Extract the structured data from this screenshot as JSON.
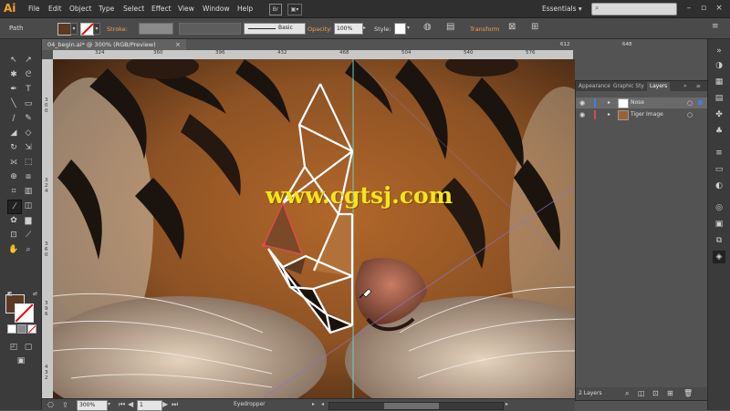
{
  "app": {
    "logo": "Ai"
  },
  "menu": [
    "File",
    "Edit",
    "Object",
    "Type",
    "Select",
    "Effect",
    "View",
    "Window",
    "Help"
  ],
  "menubar": {
    "bridge": "Br",
    "arrange": "▣▾",
    "workspace": "Essentials ▾",
    "search_placeholder": ""
  },
  "control": {
    "selection_label": "Path",
    "stroke_label": "Stroke:",
    "brush_label": "Basic",
    "opacity_label": "Opacity:",
    "opacity_value": "100%",
    "style_label": "Style:",
    "transform_label": "Transform"
  },
  "document": {
    "tab_title": "04_begin.ai* @ 300% (RGB/Preview)",
    "close": "×"
  },
  "ruler": {
    "h_ticks": [
      "324",
      "360",
      "396",
      "432",
      "468",
      "504",
      "540",
      "576",
      "612",
      "648"
    ],
    "v_ticks": [
      "3 0 0",
      "3 2 4",
      "3 6 0",
      "3 9 6",
      "4 3 2"
    ]
  },
  "status": {
    "zoom": "300%",
    "artboard": "1",
    "tool": "Eyedropper"
  },
  "layers": {
    "tabs": [
      "Appearance",
      "Graphic Sty",
      "Layers"
    ],
    "items": [
      {
        "name": "Nose",
        "color": "#4a7bd6"
      },
      {
        "name": "Tiger Image",
        "color": "#d64a4a"
      }
    ],
    "count": "2 Layers"
  },
  "watermark": "www.cgtsj.com",
  "colors": {
    "accent": "#f0a14d",
    "fill": "#5a3a22",
    "guide": "#5fd6c6"
  }
}
